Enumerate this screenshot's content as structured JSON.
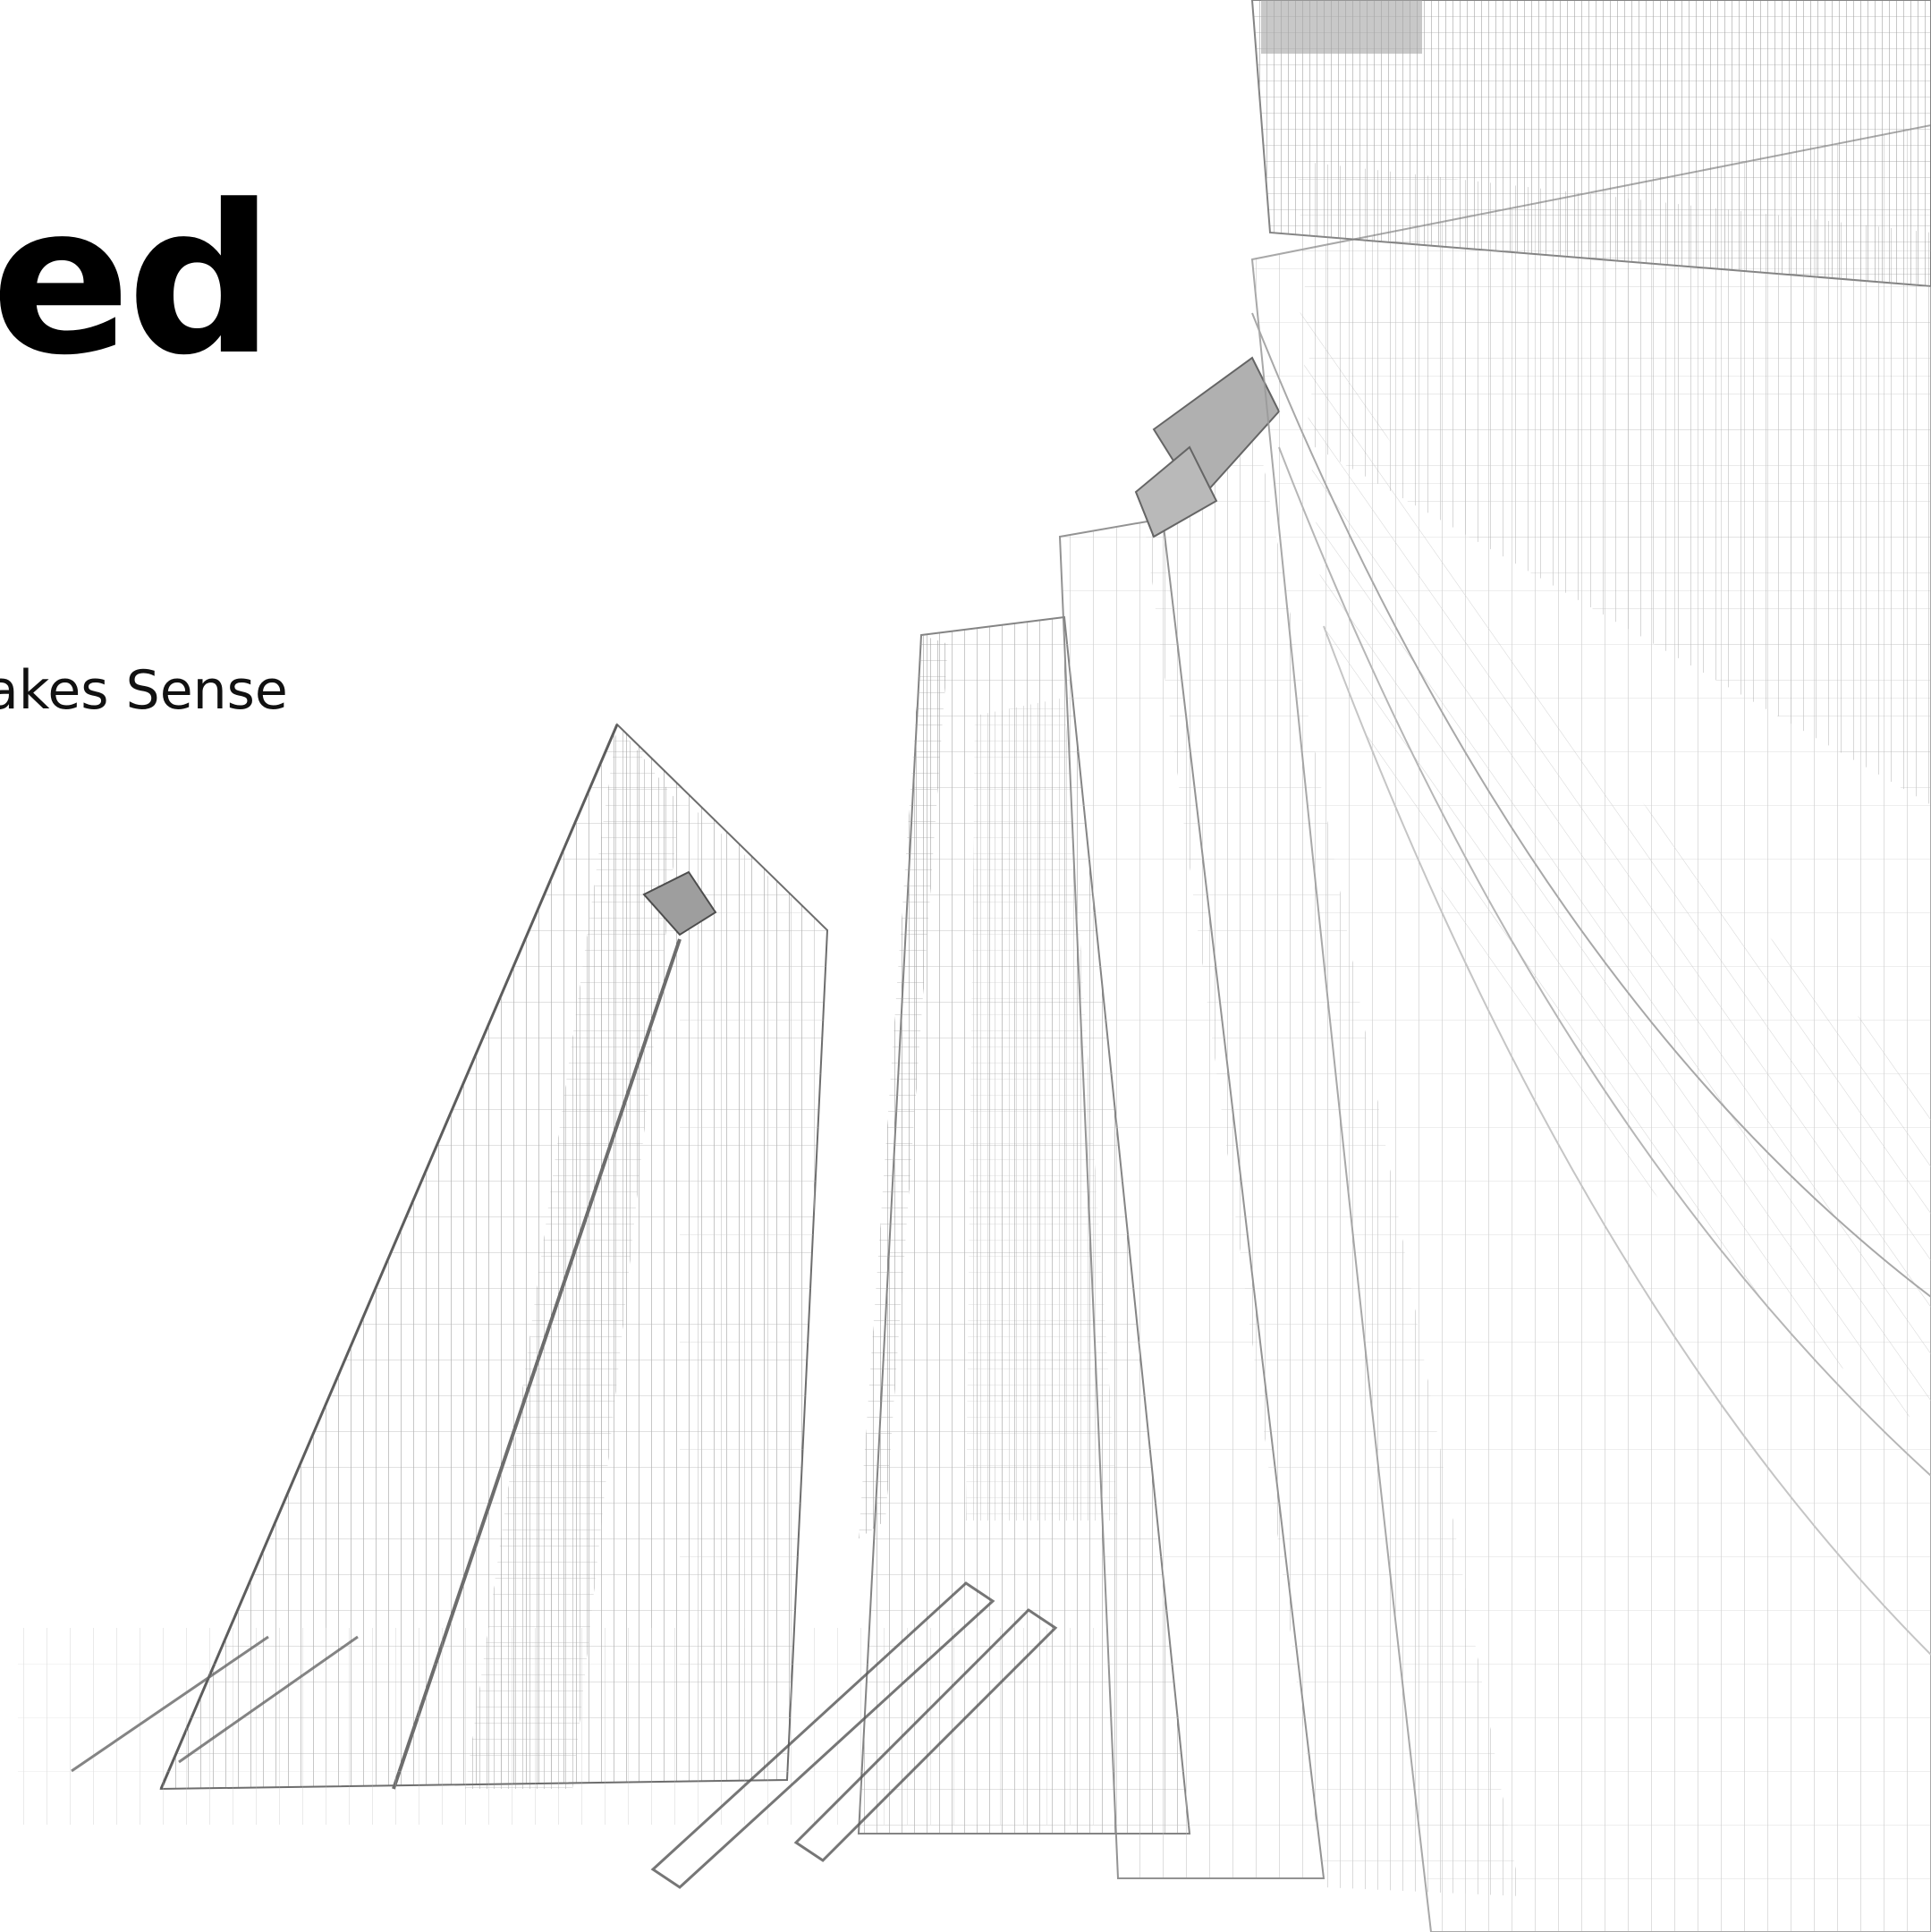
{
  "slide": {
    "headline": "ed",
    "subtitle": "akes Sense"
  },
  "background": {
    "image_subject": "architectural-wireframe-skyscrapers",
    "line_color": "#7a7a7a",
    "background_color": "#ffffff"
  }
}
